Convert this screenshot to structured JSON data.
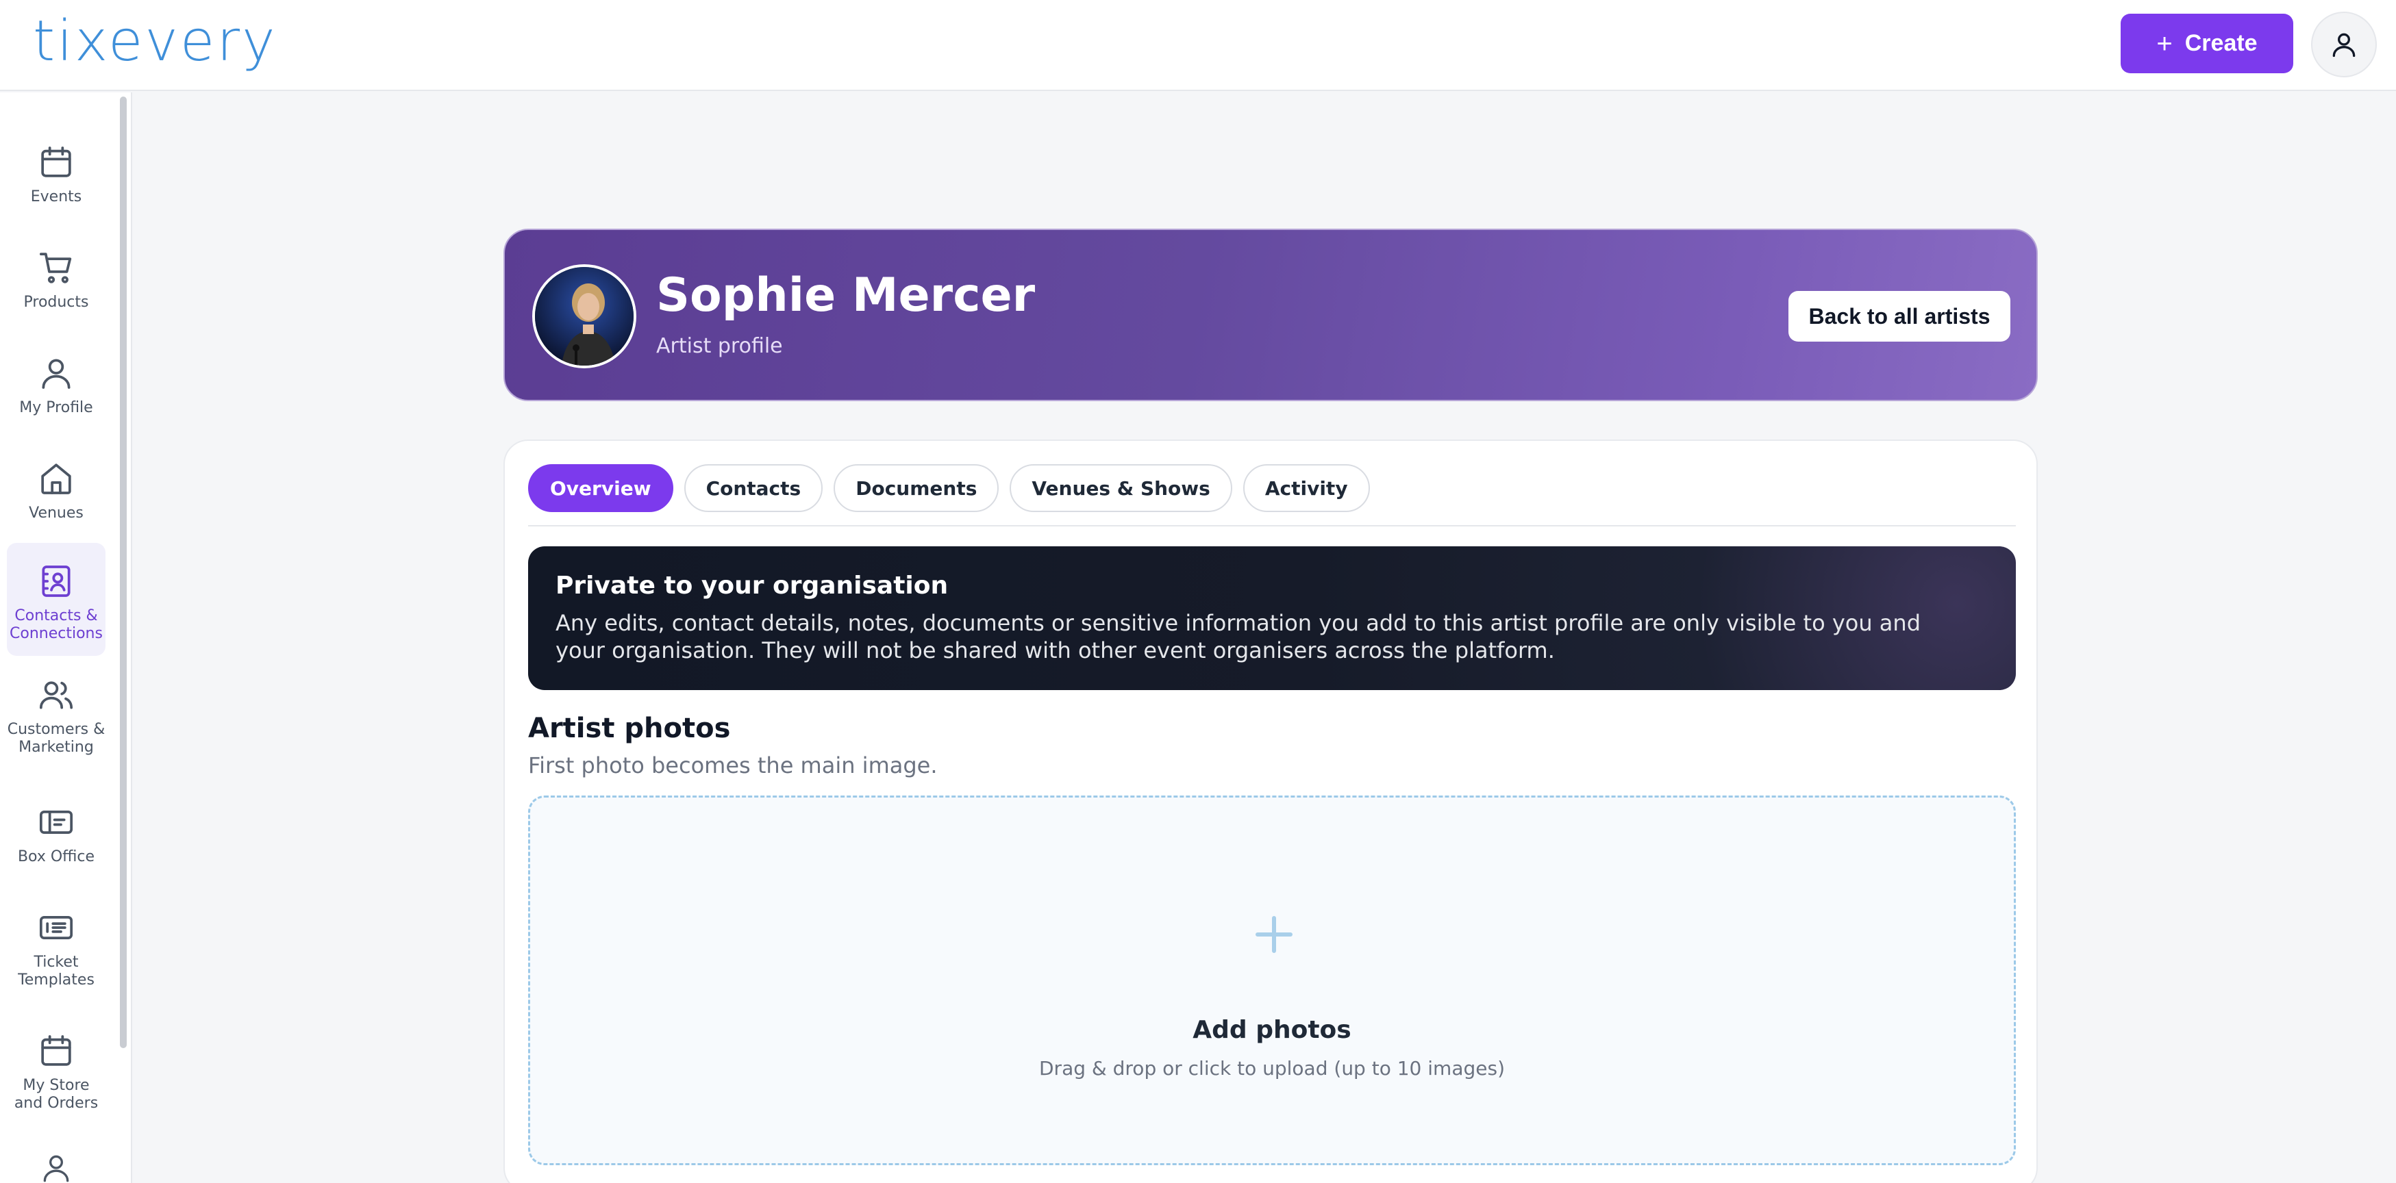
{
  "app": {
    "logo_text": "tixevery"
  },
  "header": {
    "create_label": "Create"
  },
  "sidebar": {
    "items": [
      {
        "label": "Events",
        "icon": "calendar-icon"
      },
      {
        "label": "Products",
        "icon": "cart-icon"
      },
      {
        "label": "My Profile",
        "icon": "user-icon"
      },
      {
        "label": "Venues",
        "icon": "home-icon"
      },
      {
        "label": "Contacts & Connections",
        "icon": "contacts-book-icon",
        "active": true
      },
      {
        "label": "Customers & Marketing",
        "icon": "users-icon"
      },
      {
        "label": "Box Office",
        "icon": "box-office-icon"
      },
      {
        "label": "Ticket Templates",
        "icon": "ticket-template-icon"
      },
      {
        "label": "My Store and Orders",
        "icon": "store-calendar-icon"
      }
    ]
  },
  "profile": {
    "name": "Sophie Mercer",
    "subtitle": "Artist profile",
    "back_label": "Back to all artists"
  },
  "tabs": [
    {
      "label": "Overview",
      "active": true
    },
    {
      "label": "Contacts"
    },
    {
      "label": "Documents"
    },
    {
      "label": "Venues & Shows"
    },
    {
      "label": "Activity"
    }
  ],
  "notice": {
    "title": "Private to your organisation",
    "text": "Any edits, contact details, notes, documents or sensitive information you add to this artist profile are only visible to you and your organisation. They will not be shared with other event organisers across the platform."
  },
  "photos": {
    "title": "Artist photos",
    "subtitle": "First photo becomes the main image.",
    "drop_title": "Add photos",
    "drop_subtitle": "Drag & drop or click to upload (up to 10 images)"
  },
  "colors": {
    "accent": "#7c3aed",
    "logo": "#3f8fd9",
    "notice_bg": "#161b29"
  }
}
